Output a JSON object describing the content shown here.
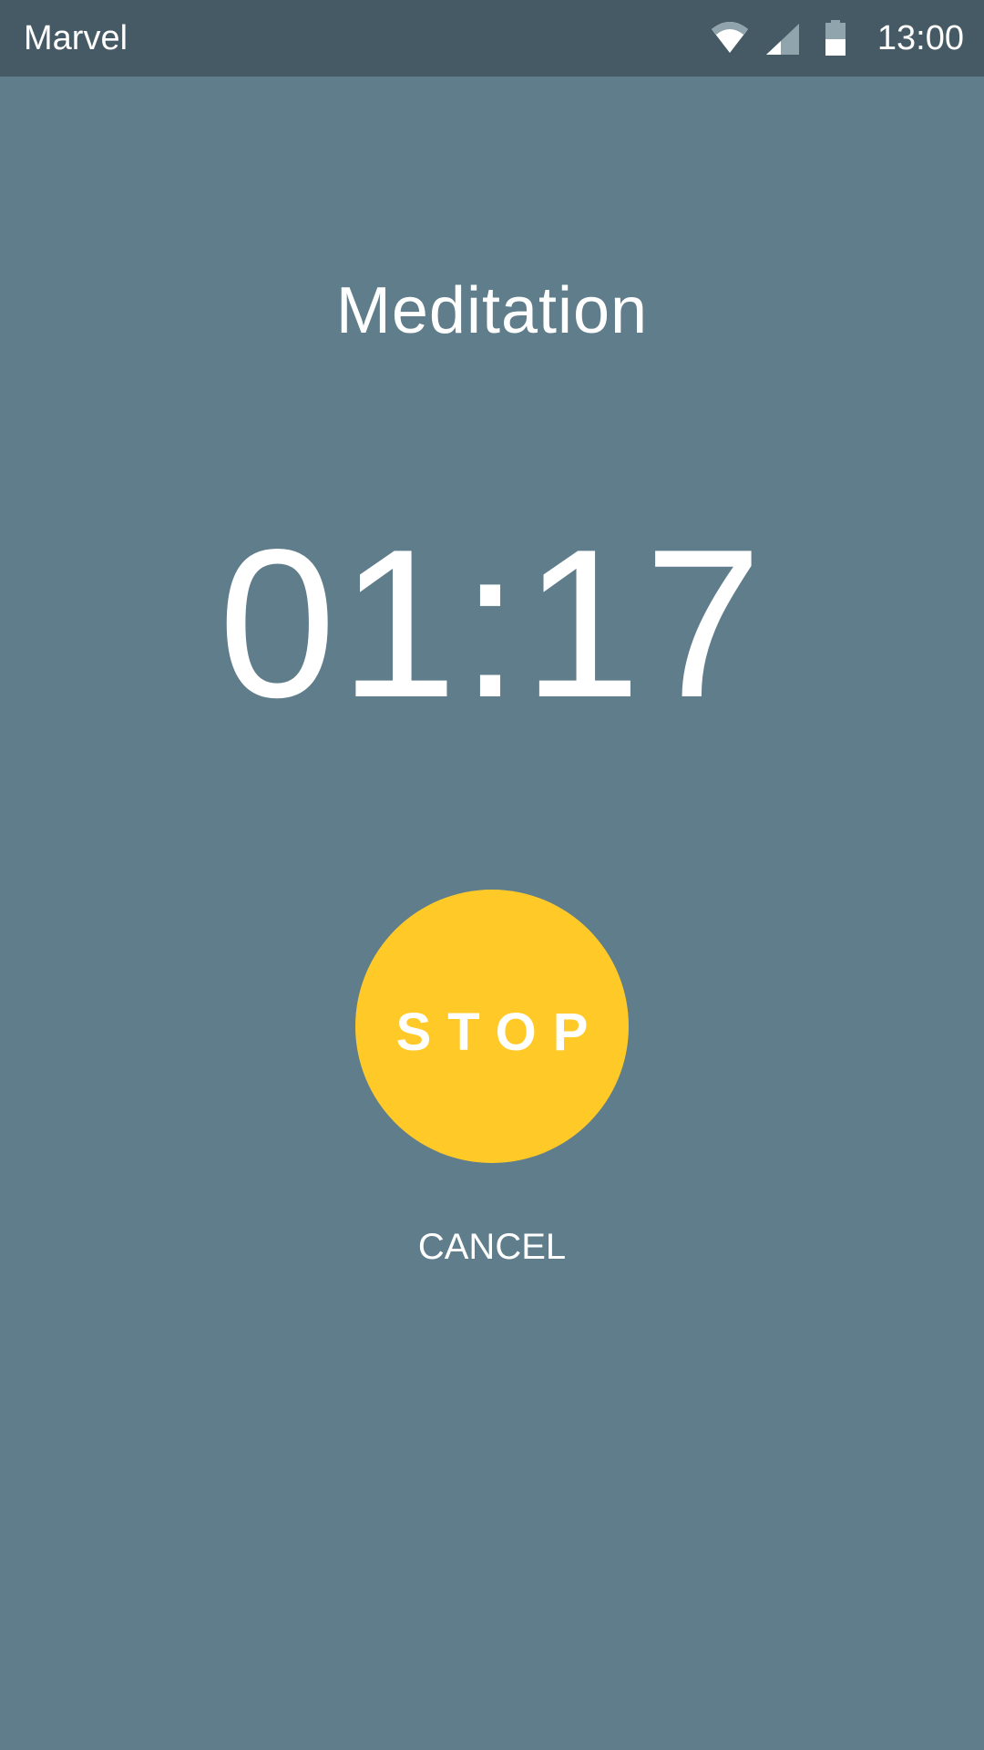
{
  "status_bar": {
    "app_name": "Marvel",
    "time": "13:00",
    "icons": [
      "wifi-icon",
      "cellular-signal-icon",
      "battery-icon"
    ]
  },
  "screen": {
    "title": "Meditation",
    "timer": "01:17",
    "stop_label": "STOP",
    "cancel_label": "CANCEL"
  },
  "colors": {
    "background": "#607d8b",
    "status_bar": "#455a64",
    "accent": "#ffca28",
    "text": "#ffffff"
  }
}
